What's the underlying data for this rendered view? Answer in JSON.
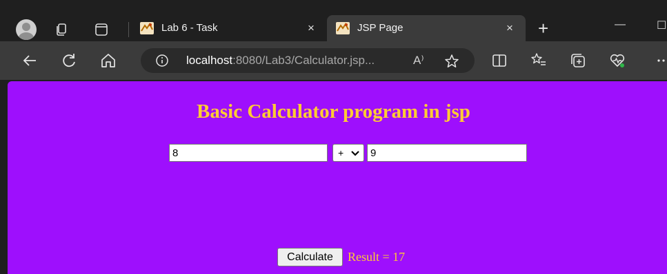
{
  "colors": {
    "page_background": "#9e0ffd",
    "heading": "#ffcc33",
    "result_text": "#ffcc33",
    "browser_chrome": "#1f1f1f",
    "toolbar": "#3b3b3b"
  },
  "browser": {
    "profile_icon": "profile-avatar-icon",
    "tabs": [
      {
        "title": "Lab 6 - Task",
        "active": false,
        "favicon": "jsp-favicon-icon"
      },
      {
        "title": "JSP Page",
        "active": true,
        "favicon": "jsp-favicon-icon"
      }
    ],
    "new_tab_label": "+",
    "close_tab_label": "×",
    "minimize_label": "—",
    "maximize_label": "☐",
    "address": {
      "host": "localhost",
      "path": ":8080/Lab3/Calculator.jsp...",
      "read_aloud_label": "A⁾"
    }
  },
  "page": {
    "heading": "Basic Calculator program in jsp",
    "first_number": "8",
    "operator": "+",
    "operator_options": [
      "+"
    ],
    "second_number": "9",
    "button_label": "Calculate",
    "result_text": "Result = 17"
  }
}
